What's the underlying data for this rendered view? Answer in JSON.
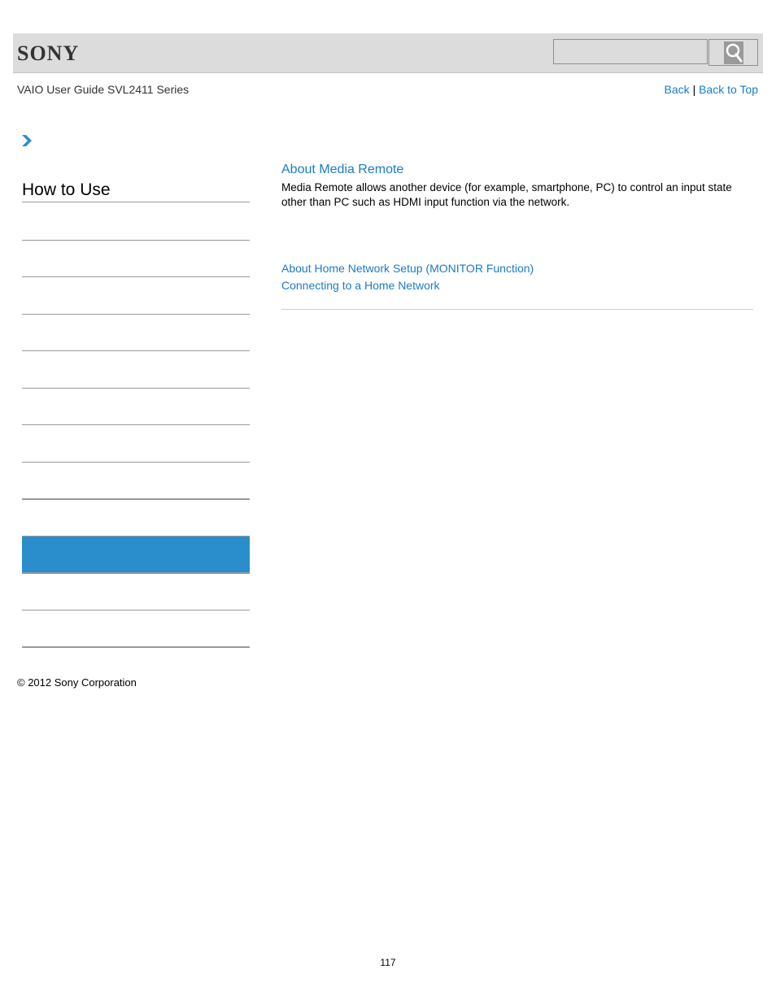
{
  "header": {
    "logo_text": "SONY",
    "search_placeholder": "",
    "search_icon": "search-icon"
  },
  "subheader": {
    "guide_title": "VAIO User Guide SVL2411 Series",
    "back_label": "Back",
    "separator": "|",
    "back_to_top_label": "Back to Top"
  },
  "breadcrumb": {
    "icon": "chevron-right-icon"
  },
  "sidebar": {
    "heading": "How to Use",
    "items": [
      {
        "label": "",
        "active": false
      },
      {
        "label": "",
        "active": false
      },
      {
        "label": "",
        "active": false
      },
      {
        "label": "",
        "active": false
      },
      {
        "label": "",
        "active": false
      },
      {
        "label": "",
        "active": false
      },
      {
        "label": "",
        "active": false
      },
      {
        "label": "",
        "active": false
      },
      {
        "label": "",
        "active": true
      },
      {
        "label": "",
        "active": false
      },
      {
        "label": "",
        "active": false
      }
    ],
    "active_color": "#2a8ecd"
  },
  "main": {
    "title": "About Media Remote",
    "body": "Media Remote allows another device (for example, smartphone, PC) to control an input state other than PC such as HDMI input function via the network.",
    "related_links": [
      "About Home Network Setup (MONITOR Function)",
      "Connecting to a Home Network"
    ]
  },
  "footer": {
    "copyright": "© 2012 Sony Corporation",
    "page_number": "117"
  },
  "colors": {
    "link": "#1a7bc9",
    "header_bg": "#dcdcdc"
  }
}
